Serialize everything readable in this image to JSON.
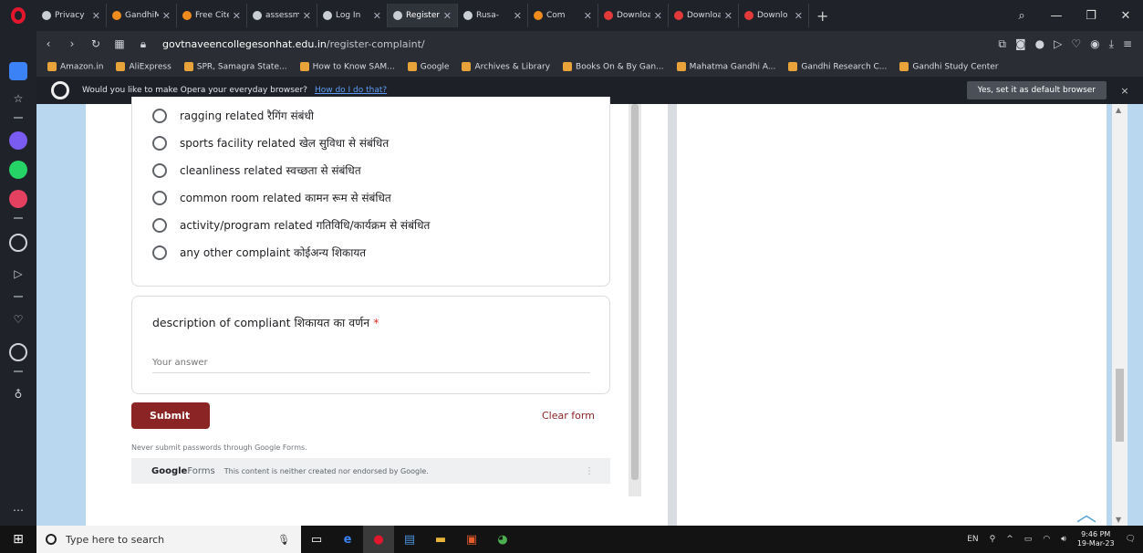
{
  "browser": {
    "tabs": [
      {
        "label": "Privacy",
        "favicon": "globe-icon"
      },
      {
        "label": "GandhiM",
        "favicon": "site-icon"
      },
      {
        "label": "Free Cite",
        "favicon": "site-icon"
      },
      {
        "label": "assessm",
        "favicon": "globe-icon"
      },
      {
        "label": "Log In",
        "favicon": "globe-icon"
      },
      {
        "label": "Register",
        "favicon": "globe-icon",
        "active": true
      },
      {
        "label": "Rusa-",
        "favicon": "globe-icon"
      },
      {
        "label": "Com",
        "favicon": "site-icon"
      },
      {
        "label": "Downloa",
        "favicon": "heart-icon"
      },
      {
        "label": "Downloa",
        "favicon": "heart-icon"
      },
      {
        "label": "Downlo",
        "favicon": "heart-icon"
      }
    ],
    "url_domain": "govtnaveencollegesonhat.edu.in",
    "url_path": "/register-complaint/",
    "bookmarks": [
      "Amazon.in",
      "AliExpress",
      "SPR, Samagra State...",
      "How to Know SAM...",
      "Google",
      "Archives & Library",
      "Books On & By Gan...",
      "Mahatma Gandhi A...",
      "Gandhi Research C...",
      "Gandhi Study Center"
    ],
    "notice": {
      "text": "Would you like to make Opera your everyday browser?",
      "link": "How do I do that?",
      "button": "Yes, set it as default browser",
      "close": "×"
    }
  },
  "form": {
    "options": [
      "ragging related रैगिंग संबंधी",
      "sports facility related खेल सुविधा से संबंधित",
      "cleanliness related स्वच्छता से संबंधित",
      "common room related कामन रूम से संबंधित",
      "activity/program related गतिविधि/कार्यक्रम से संबंधित",
      "any other complaint कोईअन्य  शिकायत"
    ],
    "description_label": "description of compliant शिकायत का वर्णन",
    "required_mark": "*",
    "answer_placeholder": "Your answer",
    "submit": "Submit",
    "clear": "Clear form",
    "never_submit": "Never submit passwords through Google Forms.",
    "footer_logo_bold": "Google",
    "footer_logo_rest": "Forms",
    "footer_text": "This content is neither created nor endorsed by Google."
  },
  "taskbar": {
    "search_placeholder": "Type here to search",
    "lang": "EN",
    "time": "9:46 PM",
    "date": "19-Mar-23"
  }
}
